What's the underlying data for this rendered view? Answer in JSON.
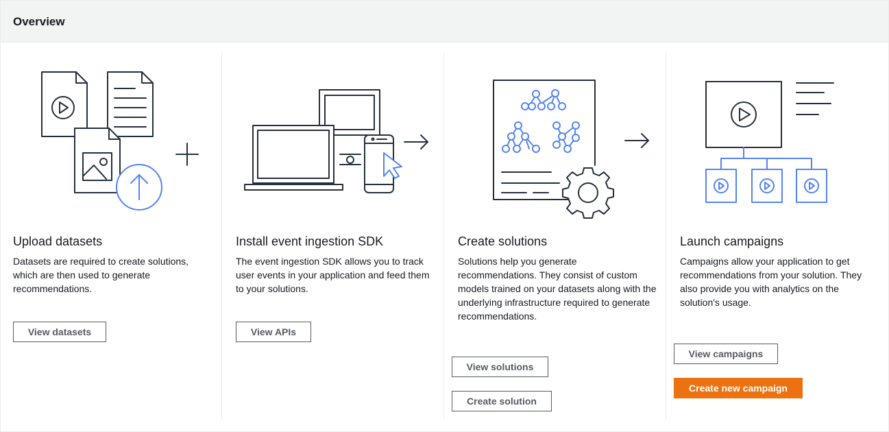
{
  "panel": {
    "title": "Overview"
  },
  "steps": [
    {
      "title": "Upload datasets",
      "description": "Datasets are required to create solutions, which are then used to generate recommendations.",
      "buttons": [
        "View datasets"
      ]
    },
    {
      "title": "Install event ingestion SDK",
      "description": "The event ingestion SDK allows you to track user events in your application and feed them to your solutions.",
      "buttons": [
        "View APIs"
      ]
    },
    {
      "title": "Create solutions",
      "description": "Solutions help you generate recommendations. They consist of custom models trained on your datasets along with the underlying infrastructure required to generate recommendations.",
      "buttons": [
        "View solutions",
        "Create solution"
      ]
    },
    {
      "title": "Launch campaigns",
      "description": "Campaigns allow your application to get recommendations from your solution. They also provide you with analytics on the solution's usage.",
      "buttons": [
        "View campaigns",
        "Create new campaign"
      ]
    }
  ],
  "colors": {
    "primary_button": "#ec7211",
    "icon_stroke": "#232f3e",
    "icon_accent": "#5384f0",
    "header_bg": "#f2f3f3"
  },
  "icons": [
    "upload-datasets-illustration",
    "install-sdk-illustration",
    "create-solutions-illustration",
    "launch-campaigns-illustration"
  ]
}
